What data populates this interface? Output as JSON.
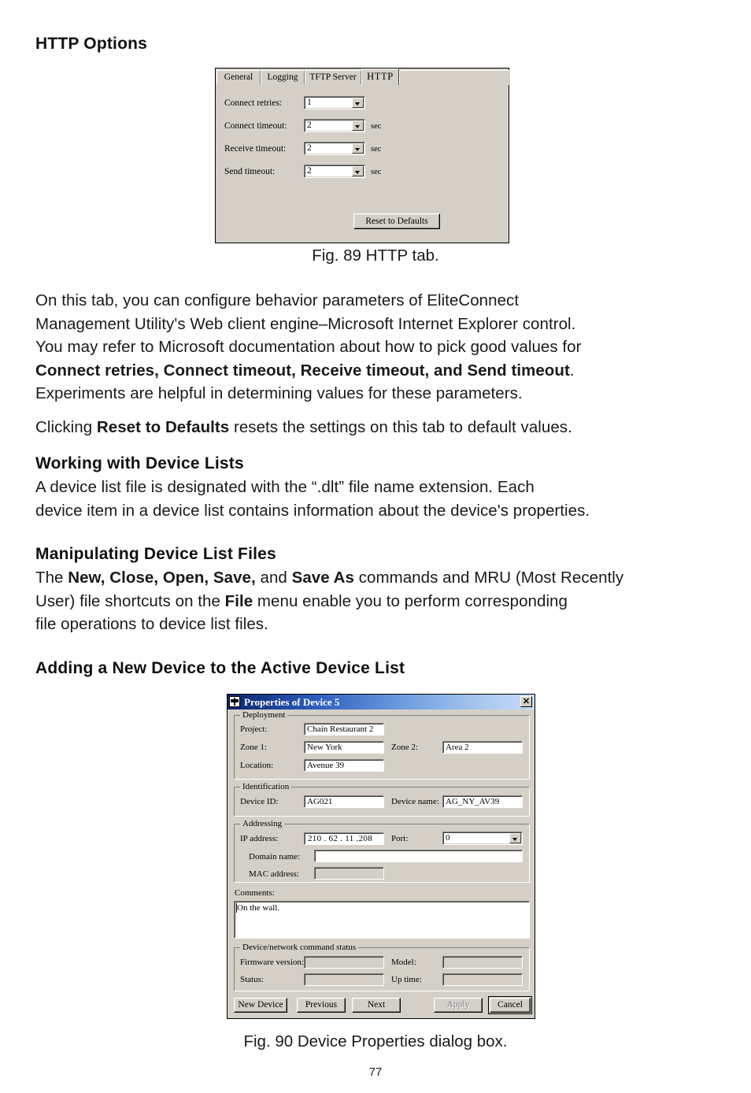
{
  "page": {
    "number": "77",
    "heading_http_options": "HTTP Options",
    "heading_working_device_lists": "Working with Device Lists",
    "heading_manipulating": "Manipulating Device List Files",
    "heading_adding_device": "Adding a New Device to the Active Device List",
    "fig89_caption": "Fig. 89 HTTP tab.",
    "fig90_caption": "Fig. 90 Device Properties dialog box.",
    "para1_line1": "On this tab, you can configure behavior parameters of EliteConnect",
    "para1_line2": "Management Utility's Web client engine–Microsoft Internet Explorer control.",
    "para1_line3": "You may refer to Microsoft documentation about how to pick good values for",
    "para1_line4_bold": "Connect retries, Connect timeout, Receive timeout, and Send timeout",
    "para1_line4_tail": ".",
    "para1_line5": "Experiments are helpful in determining values for these parameters.",
    "para2_pre": "Clicking ",
    "para2_bold": "Reset to Defaults",
    "para2_post": " resets the settings on this tab to default values.",
    "para3_line1": "A device list file is designated with the “.dlt” file name extension. Each",
    "para3_line2": "device item in a device list contains information about the device's properties.",
    "para4_pre": "The ",
    "para4_bold1": "New, Close, Open, Save,",
    "para4_mid": " and ",
    "para4_bold2": "Save As",
    "para4_post": " commands and MRU (Most Recently",
    "para4_line2_pre": "User) file shortcuts on the ",
    "para4_line2_bold": "File",
    "para4_line2_post": " menu enable you to perform corresponding",
    "para4_line3": "file operations to device list files."
  },
  "fig89": {
    "tabs": [
      {
        "label": "General",
        "active": false
      },
      {
        "label": "Logging",
        "active": false
      },
      {
        "label": "TFTP Server",
        "active": false
      },
      {
        "label": "HTTP",
        "active": true
      }
    ],
    "fields": [
      {
        "label": "Connect retries:",
        "value": "1",
        "unit": ""
      },
      {
        "label": "Connect timeout:",
        "value": "2",
        "unit": "sec"
      },
      {
        "label": "Receive timeout:",
        "value": "2",
        "unit": "sec"
      },
      {
        "label": "Send timeout:",
        "value": "2",
        "unit": "sec"
      }
    ],
    "reset_button": "Reset to Defaults"
  },
  "fig90": {
    "title": "Properties of Device 5",
    "close_label": "✕",
    "groups": {
      "deployment": {
        "title": "Deployment",
        "project_label": "Project:",
        "project_value": "Chain Restaurant 2",
        "zone1_label": "Zone 1:",
        "zone1_value": "New York",
        "zone2_label": "Zone 2:",
        "zone2_value": "Area 2",
        "location_label": "Location:",
        "location_value": "Avenue 39"
      },
      "identification": {
        "title": "Identification",
        "device_id_label": "Device ID:",
        "device_id_value": "AG021",
        "device_name_label": "Device name:",
        "device_name_value": "AG_NY_AV39"
      },
      "addressing": {
        "title": "Addressing",
        "ip_label": "IP address:",
        "ip_value": "210 . 62 . 11 .208",
        "port_label": "Port:",
        "port_value": "0",
        "domain_label": "Domain name:",
        "domain_value": "",
        "mac_label": "MAC address:",
        "mac_value": ""
      },
      "comments": {
        "label": "Comments:",
        "value": "On the wall."
      },
      "command_status": {
        "title": "Device/network command status",
        "firmware_label": "Firmware version:",
        "firmware_value": "",
        "model_label": "Model:",
        "model_value": "",
        "status_label": "Status:",
        "status_value": "",
        "uptime_label": "Up time:",
        "uptime_value": ""
      }
    },
    "buttons": {
      "new_device": "New Device",
      "previous": "Previous",
      "next": "Next",
      "apply": "Apply",
      "cancel": "Cancel"
    }
  }
}
